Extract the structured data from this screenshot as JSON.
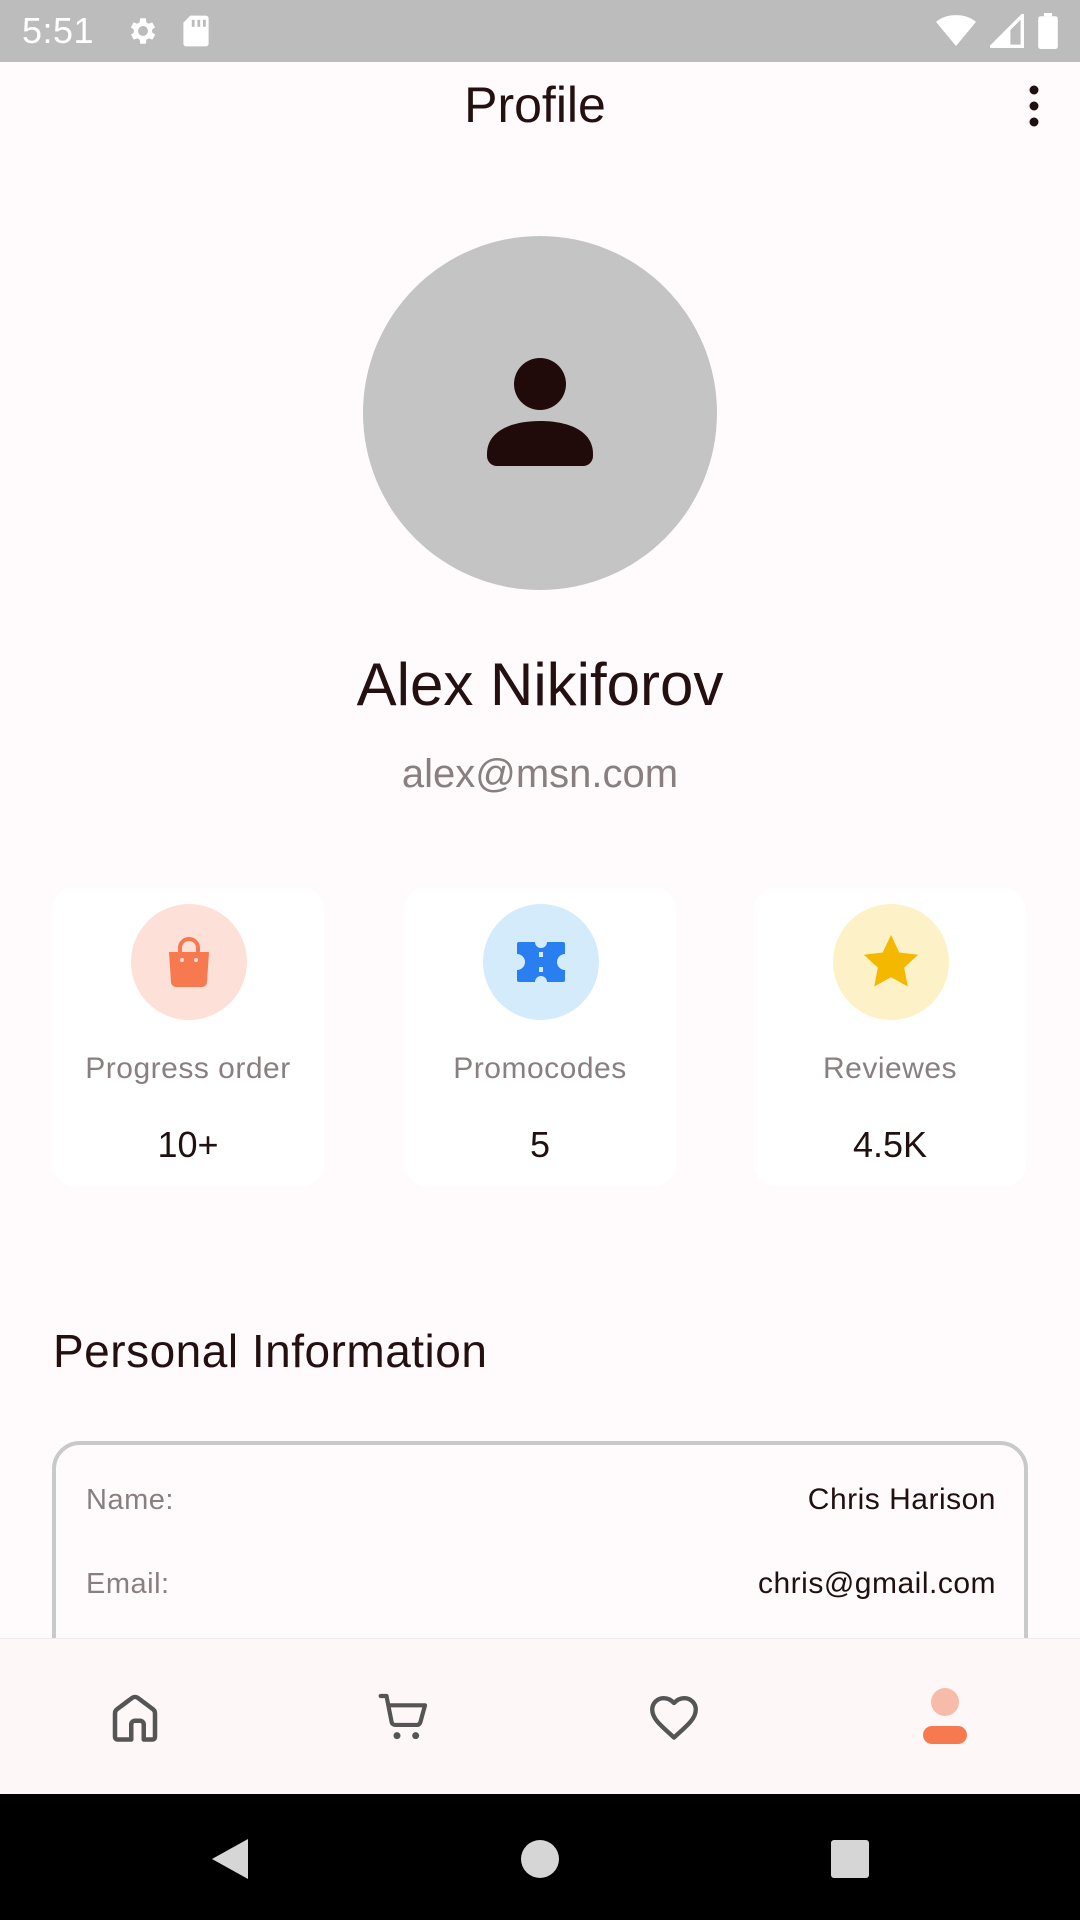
{
  "status_bar": {
    "time": "5:51",
    "left_icons": [
      "gear-icon",
      "sd-card-icon"
    ],
    "right_icons": [
      "wifi-icon",
      "signal-icon",
      "battery-icon"
    ]
  },
  "app_bar": {
    "title": "Profile",
    "menu_icon": "more-vertical-icon"
  },
  "profile": {
    "avatar_icon": "person-icon",
    "name": "Alex Nikiforov",
    "email": "alex@msn.com"
  },
  "stats": [
    {
      "label": "Progress order",
      "value": "10+",
      "icon": "shopping-bag-icon",
      "icon_color": "#f7794f",
      "bg_color": "#fde0d8"
    },
    {
      "label": "Promocodes",
      "value": "5",
      "icon": "ticket-icon",
      "icon_color": "#2a7ff0",
      "bg_color": "#d4ebfb"
    },
    {
      "label": "Reviewes",
      "value": "4.5K",
      "icon": "star-icon",
      "icon_color": "#f5b800",
      "bg_color": "#fdf1c7"
    }
  ],
  "personal_info": {
    "title": "Personal Information",
    "rows": [
      {
        "key": "Name:",
        "value": "Chris Harison"
      },
      {
        "key": "Email:",
        "value": "chris@gmail.com"
      }
    ]
  },
  "bottom_nav": {
    "items": [
      "home-icon",
      "cart-icon",
      "heart-icon",
      "profile-icon"
    ],
    "active": "profile-icon",
    "accent_color": "#f7794f"
  },
  "system_nav": [
    "back-icon",
    "home-circle-icon",
    "recents-icon"
  ]
}
